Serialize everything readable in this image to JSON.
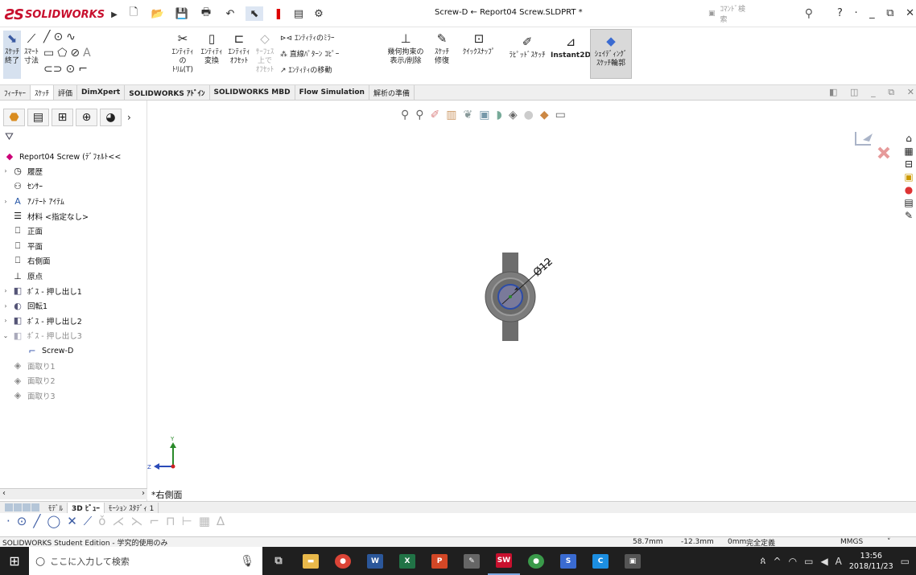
{
  "app": {
    "brand": "SOLIDWORKS",
    "doc_title": "Screw-D ← Report04 Screw.SLDPRT *",
    "command_search_placeholder": "ｺﾏﾝﾄﾞ検索",
    "help": "?"
  },
  "ribbon": {
    "sketch_end": "ｽｹｯﾁ\n終了",
    "smart_dimension": "ｽﾏｰﾄ\n寸法",
    "trim": "ｴﾝﾃｨﾃｨの\nﾄﾘﾑ(T)",
    "convert": "ｴﾝﾃｨﾃｨ\n変換",
    "offset": "ｴﾝﾃｨﾃｨ\nｵﾌｾｯﾄ",
    "surface_offset": "ｻｰﾌｪｽ\n上で\nｵﾌｾｯﾄ",
    "mirror": "ｴﾝﾃｨﾃｨのﾐﾗｰ",
    "linear_pattern": "直線ﾊﾟﾀｰﾝ ｺﾋﾟｰ",
    "move": "ｴﾝﾃｨﾃｨの移動",
    "relations": "幾何拘束の\n表示/削除",
    "repair": "ｽｹｯﾁ\n修復",
    "quick_snap": "ｸｲｯｸｽﾅｯﾌﾟ",
    "rapid_sketch": "ﾗﾋﾟｯﾄﾞｽｹｯﾁ",
    "instant2d": "Instant2D",
    "shaded": "ｼｪｲﾃﾞｨﾝｸﾞ\nｽｹｯﾁ輪郭"
  },
  "tabs": [
    "ﾌｨｰﾁｬｰ",
    "ｽｹｯﾁ",
    "評価",
    "DimXpert",
    "SOLIDWORKS ｱﾄﾞｲﾝ",
    "SOLIDWORKS MBD",
    "Flow Simulation",
    "解析の準備"
  ],
  "tree": {
    "root": "Report04 Screw  (ﾃﾞﾌｫﾙﾄ<<",
    "history": "履歴",
    "sensors": "ｾﾝｻｰ",
    "annotations": "ｱﾉﾃｰﾄ ｱｲﾃﾑ",
    "material": "材料 <指定なし>",
    "front": "正面",
    "top": "平面",
    "right": "右側面",
    "origin": "原点",
    "boss1": "ﾎﾞｽ - 押し出し1",
    "revolve": "回転1",
    "boss2": "ﾎﾞｽ - 押し出し2",
    "boss3": "ﾎﾞｽ - 押し出し3",
    "sketch": "Screw-D",
    "chamfer1": "面取り1",
    "chamfer2": "面取り2",
    "chamfer3": "面取り3"
  },
  "viewport": {
    "dimension": "Ø12",
    "pane_label": "*右側面",
    "triad_y": "Y",
    "triad_z": "Z"
  },
  "bottom_tabs": [
    "ﾓﾃﾞﾙ",
    "3D ﾋﾞｭｰ",
    "ﾓｰｼｮﾝ ｽﾀﾃﾞｨ 1"
  ],
  "status": {
    "edition": "SOLIDWORKS Student Edition - 学究的使用のみ",
    "x": "58.7mm",
    "y": "-12.3mm",
    "z": "0mm",
    "state": "完全定義",
    "units": "MMGS"
  },
  "taskbar": {
    "search_placeholder": "ここに入力して検索",
    "time": "13:56",
    "date": "2018/11/23",
    "ime": "A"
  },
  "colors": {
    "accent": "#c8102e",
    "part_body": "#6d6d6d",
    "part_ring": "#8a8a8a",
    "selected_sketch": "#2d4da8"
  }
}
